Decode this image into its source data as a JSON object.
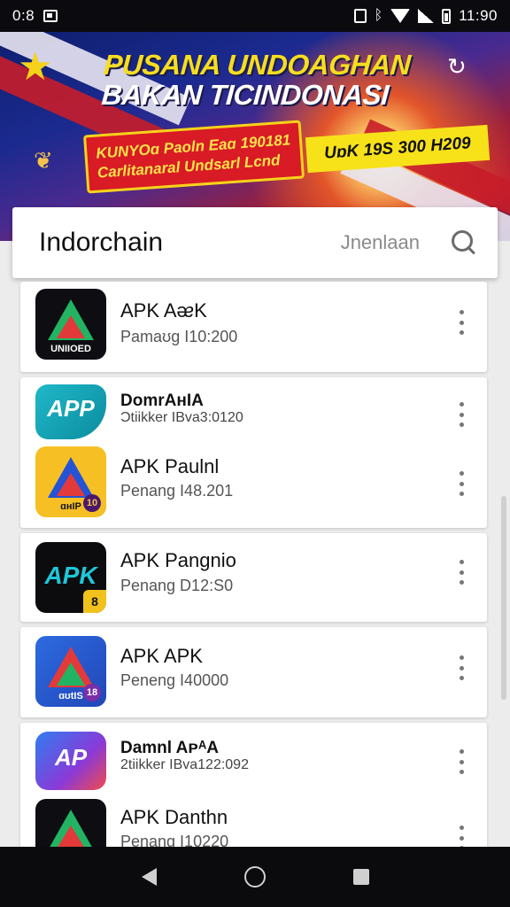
{
  "status_bar": {
    "left_text": "0:8",
    "time": "11:90",
    "icons": [
      "image-icon",
      "vibrate-icon",
      "bluetooth-icon",
      "wifi-icon",
      "signal-icon",
      "battery-icon"
    ]
  },
  "banner": {
    "title_line1": "PUSANA UNDOAGHAN",
    "title_line2": "BAKAN TICINDONASI",
    "promo_line1": "KUNYOɑ Paoln Eaɑ 190181",
    "promo_line2": "Carlitanaral Undsarl Lcnd",
    "highlight": "UɒK 19S 300 H209",
    "icons": [
      "star-icon",
      "bird-icon",
      "refresh-icon"
    ]
  },
  "search": {
    "title": "Indorchain",
    "hint": "Jnenlaan"
  },
  "apps": [
    {
      "name": "APK AᴂK",
      "subtitle": "Pamaʊg I10:200",
      "icon_label": "UNIIOED"
    },
    {
      "name": "DomrAʜIA",
      "subtitle": "Ɔtiikker IBva3:0120",
      "icon_text": "APP"
    },
    {
      "name": "APK Paulnl",
      "subtitle": "Penang I48.201",
      "icon_label": "ɑʜIP",
      "icon_badge": "10"
    },
    {
      "name": "APK Pangnio",
      "subtitle": "Penang D12:S0",
      "icon_text": "APK",
      "icon_badge": "8"
    },
    {
      "name": "APK APK",
      "subtitle": "Peneng I40000",
      "icon_label": "ɑʊtIS",
      "icon_badge": "18"
    },
    {
      "name": "Damnl AᴩᴬA",
      "subtitle": "2tiikker IBva122:092",
      "icon_text": "AP"
    },
    {
      "name": "APK Danthn",
      "subtitle": "Penang I10220"
    }
  ],
  "colors": {
    "banner_title_yellow": "#f7dd1e",
    "promo_red": "#d81b25",
    "promo_yellow": "#f7e21a",
    "card_bg": "#ffffff",
    "page_bg": "#ececec"
  }
}
